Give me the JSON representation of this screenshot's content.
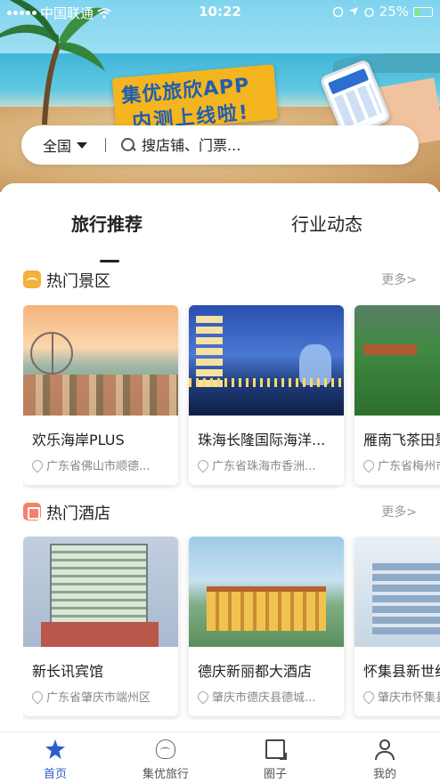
{
  "status_bar": {
    "carrier": "中国联通",
    "time": "10:22",
    "battery": "25%"
  },
  "banner": {
    "promo_line1": "集优旅欣APP",
    "promo_line2": "内测上线啦!"
  },
  "search": {
    "region": "全国",
    "placeholder": "搜店铺、门票..."
  },
  "tabs": [
    {
      "label": "旅行推荐",
      "active": true
    },
    {
      "label": "行业动态",
      "active": false
    }
  ],
  "sections": [
    {
      "title": "热门景区",
      "more": "更多>",
      "icon": "scenic-icon",
      "items": [
        {
          "name": "欢乐海岸PLUS",
          "location": "广东省佛山市顺德..."
        },
        {
          "name": "珠海长隆国际海洋...",
          "location": "广东省珠海市香洲..."
        },
        {
          "name": "雁南飞茶田景区",
          "location": "广东省梅州市梅县区"
        }
      ]
    },
    {
      "title": "热门酒店",
      "more": "更多>",
      "icon": "hotel-icon",
      "items": [
        {
          "name": "新长讯宾馆",
          "location": "广东省肇庆市端州区"
        },
        {
          "name": "德庆新丽都大酒店",
          "location": "肇庆市德庆县德城..."
        },
        {
          "name": "怀集县新世纪酒店",
          "location": "肇庆市怀集县怀城"
        }
      ]
    }
  ],
  "bottom_nav": [
    {
      "label": "首页",
      "icon": "home-star-icon",
      "active": true
    },
    {
      "label": "集优旅行",
      "icon": "mascot-icon",
      "active": false
    },
    {
      "label": "圈子",
      "icon": "chat-icon",
      "active": false
    },
    {
      "label": "我的",
      "icon": "user-icon",
      "active": false
    }
  ],
  "colors": {
    "accent": "#2a5fc9",
    "scenic_icon": "#f3b13b",
    "hotel_icon": "#f2826a"
  }
}
